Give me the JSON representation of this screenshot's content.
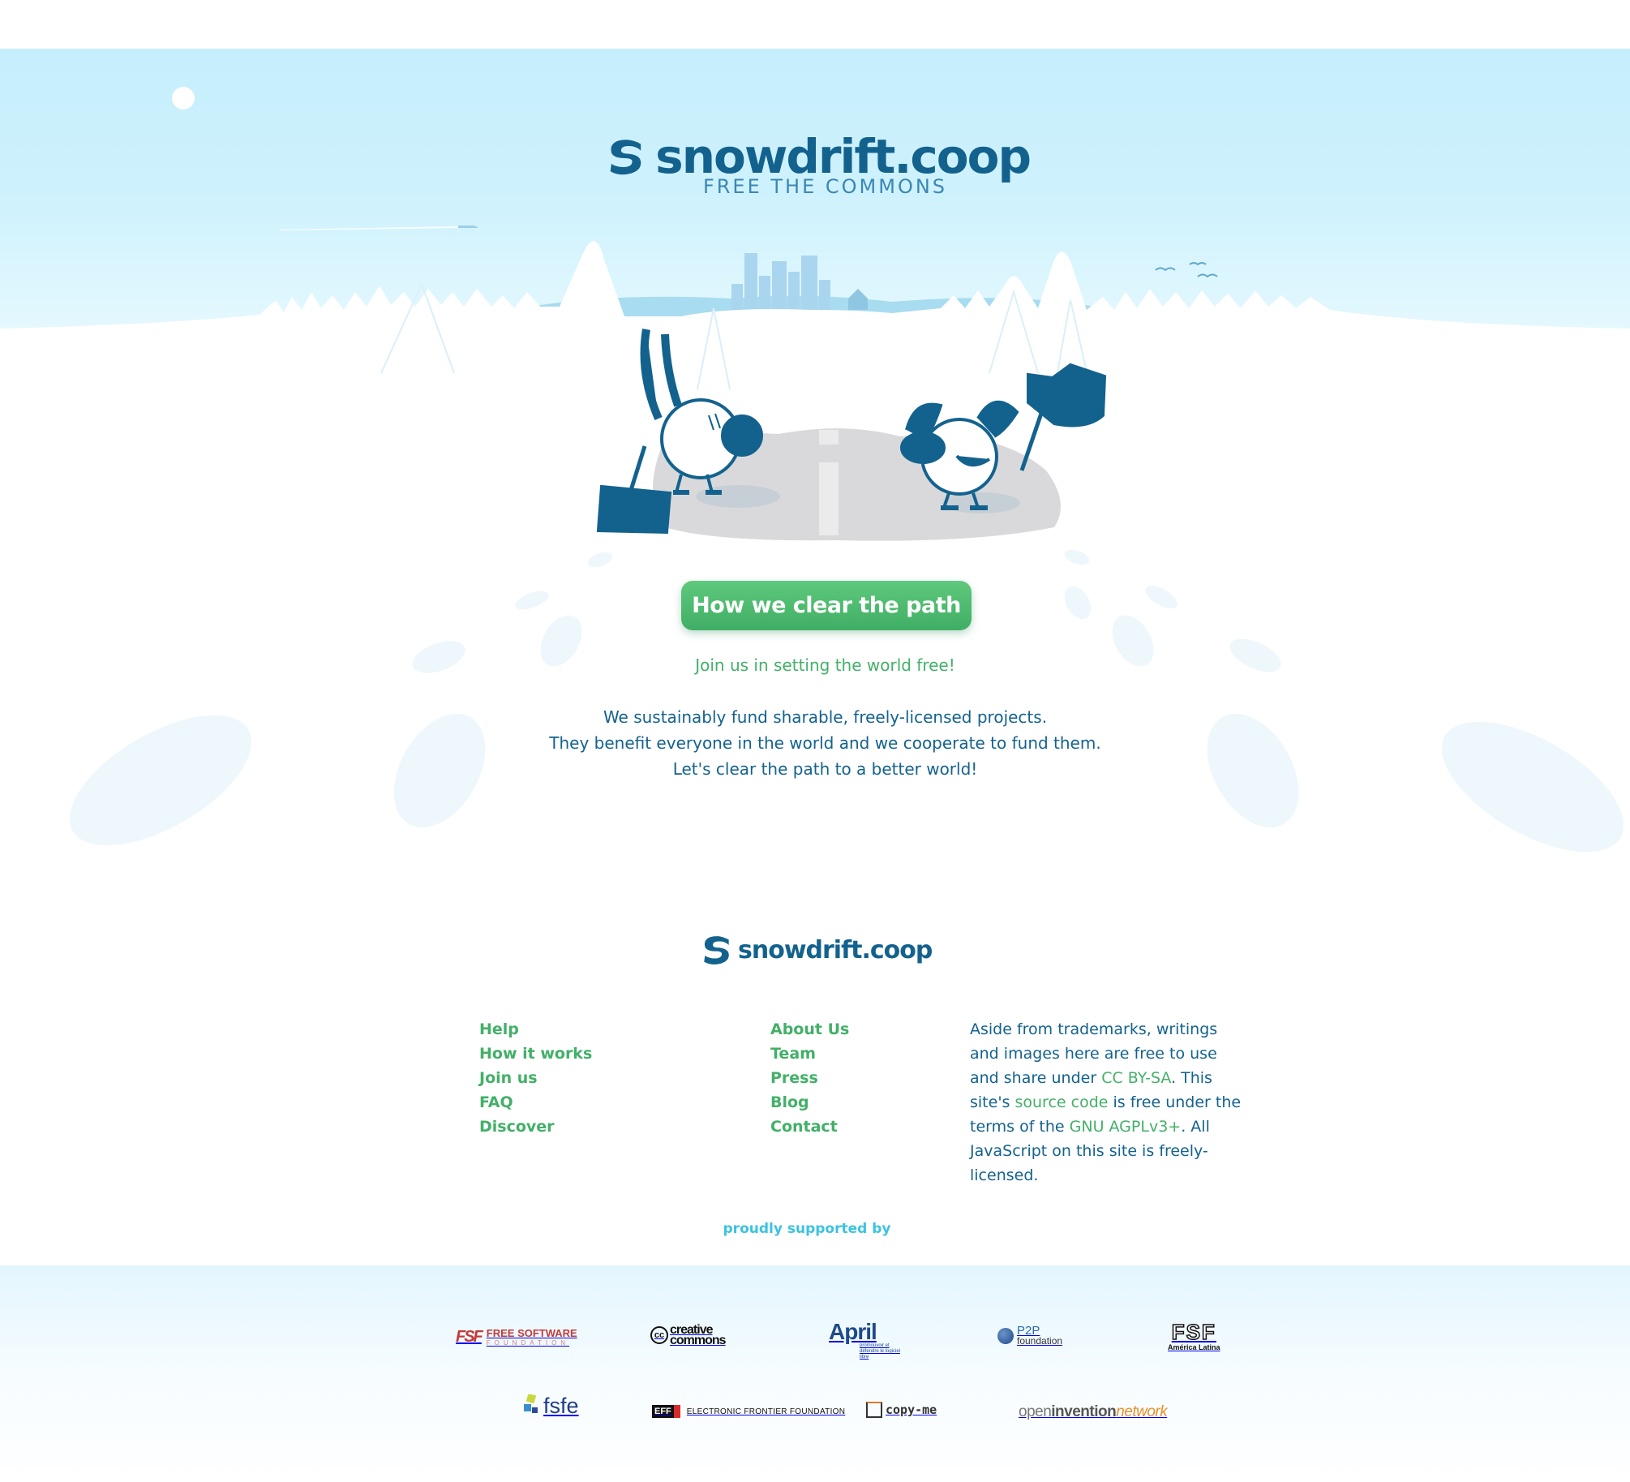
{
  "header": {
    "brand": "snowdrift.coop",
    "tagline": "FREE THE COMMONS"
  },
  "hero": {
    "cta_label": "How we clear the path",
    "join_text": "Join us in setting the world free!",
    "intro_lines": [
      "We sustainably fund sharable, freely-licensed projects.",
      "They benefit everyone in the world and we cooperate to fund them.",
      "Let's clear the path to a better world!"
    ]
  },
  "footer": {
    "brand": "snowdrift.coop",
    "col1": [
      "Help",
      "How it works",
      "Join us",
      "FAQ",
      "Discover"
    ],
    "col2": [
      "About Us",
      "Team",
      "Press",
      "Blog",
      "Contact"
    ],
    "license": {
      "p1": "Aside from trademarks, writings and images here are free to use and share under ",
      "link1": "CC BY-SA",
      "p2": ". This site's ",
      "link2": "source code",
      "p3": " is free under the terms of the ",
      "link3": "GNU AGPLv3+",
      "p4": ". All JavaScript on this site is freely-licensed."
    },
    "supported_by": "proudly supported by"
  },
  "sponsors": {
    "fsf": {
      "abbr": "FSF",
      "top": "FREE SOFTWARE",
      "bottom": "FOUNDATION"
    },
    "cc": {
      "mark": "cc",
      "line1": "creative",
      "line2": "commons"
    },
    "april": {
      "name": "April",
      "sub": "promouvoir et défendre le logiciel libre"
    },
    "p2p": {
      "name": "P2P",
      "sub": "foundation"
    },
    "fsfla": {
      "name": "FSF",
      "sub": "América Latina"
    },
    "fsfe": {
      "name": "fsfe"
    },
    "eff": {
      "mark": "EFF",
      "name": "ELECTRONIC FRONTIER FOUNDATION"
    },
    "copyme": {
      "name": "copy-me"
    },
    "oin": {
      "open": "open",
      "invention": "invention",
      "network": "network"
    }
  },
  "colors": {
    "brand_blue": "#13628e",
    "link_green": "#42b068",
    "supported_cyan": "#3bc3e0",
    "sky": "#c5eefc"
  }
}
